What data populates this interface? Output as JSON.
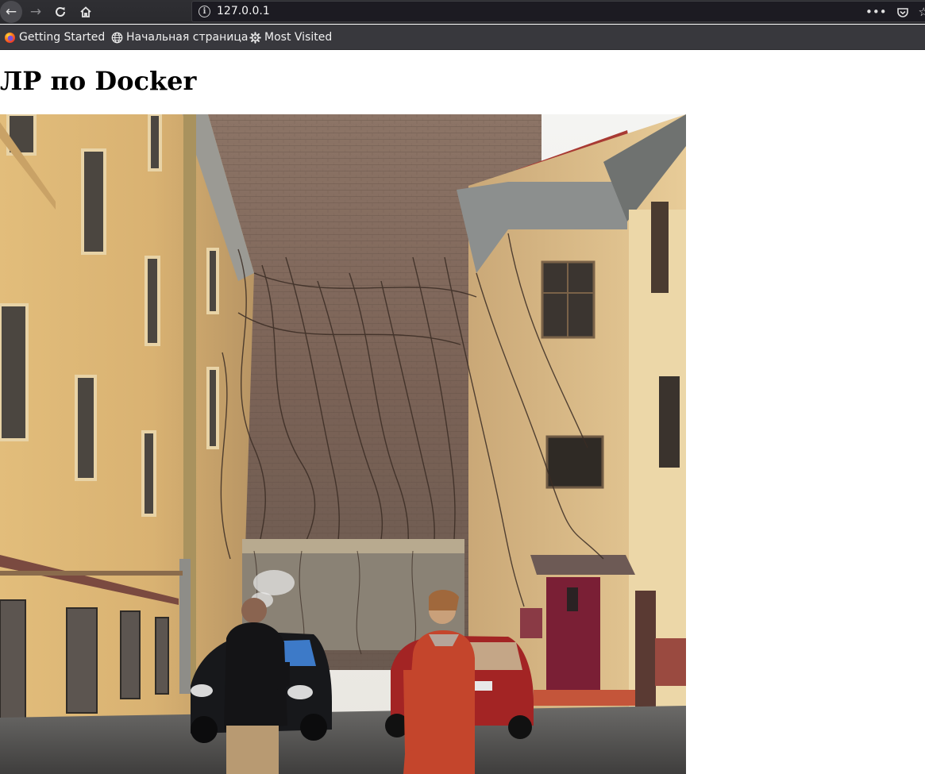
{
  "browser": {
    "url": "127.0.0.1",
    "bookmarks": [
      {
        "label": "Getting Started",
        "icon": "firefox-icon"
      },
      {
        "label": "Начальная страница",
        "icon": "globe-icon"
      },
      {
        "label": "Most Visited",
        "icon": "gear-icon"
      }
    ]
  },
  "page": {
    "heading": "ЛР по Docker",
    "image": {
      "subject": "courtyard photo"
    }
  },
  "colors": {
    "chrome_bg": "#2a2a2e",
    "bookmarks_bg": "#38383d",
    "urlbar_bg": "#1c1b22",
    "page_bg": "#ffffff"
  }
}
